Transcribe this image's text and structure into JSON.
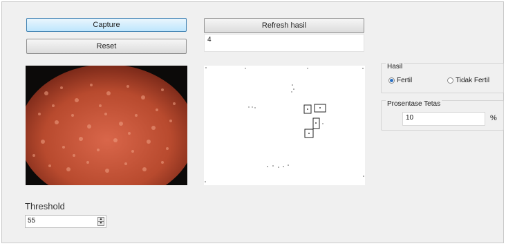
{
  "buttons": {
    "capture": "Capture",
    "reset": "Reset",
    "refresh": "Refresh hasil"
  },
  "result_box": {
    "value": "4"
  },
  "hasil_group": {
    "title": "Hasil",
    "options": [
      "Fertil",
      "Tidak Fertil"
    ],
    "selected": "Fertil"
  },
  "prosentase_group": {
    "title": "Prosentase Tetas",
    "value": "10",
    "unit": "%"
  },
  "threshold": {
    "label": "Threshold",
    "value": "55"
  },
  "colors": {
    "camera_background": "#b84a2e",
    "focused_button": "#bee6fd",
    "radio_accent": "#2a6fc1"
  },
  "icons": {
    "spin_up": "spin-up-arrow-icon",
    "spin_down": "spin-down-arrow-icon"
  }
}
